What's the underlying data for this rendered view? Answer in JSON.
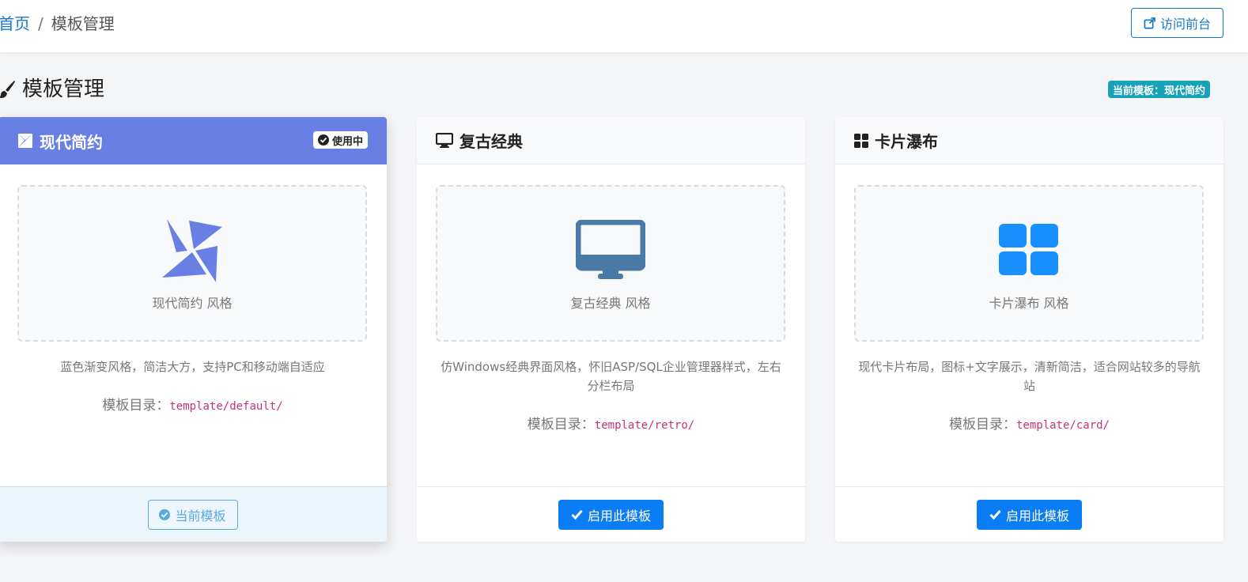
{
  "breadcrumb": {
    "home": "首页",
    "separator": "/",
    "current": "模板管理"
  },
  "header": {
    "visit_label": "访问前台"
  },
  "page": {
    "title": "模板管理",
    "current_badge": "当前模板：现代简约"
  },
  "colors": {
    "accent": "#1677c8",
    "active_head": "#6a7fe4",
    "badge": "#17a2b8",
    "primary": "#0a7cf4"
  },
  "templates": [
    {
      "name": "现代简约",
      "icon": "pinwheel-icon",
      "active": true,
      "in_use_label": "使用中",
      "style_label": "现代简约 风格",
      "description": "蓝色渐变风格，简洁大方，支持PC和移动端自适应",
      "dir_label": "模板目录：",
      "dir_path": "template/default/",
      "button_label": "当前模板"
    },
    {
      "name": "复古经典",
      "icon": "desktop-icon",
      "active": false,
      "style_label": "复古经典 风格",
      "description": "仿Windows经典界面风格，怀旧ASP/SQL企业管理器样式，左右分栏布局",
      "dir_label": "模板目录：",
      "dir_path": "template/retro/",
      "button_label": "启用此模板"
    },
    {
      "name": "卡片瀑布",
      "icon": "grid-icon",
      "active": false,
      "style_label": "卡片瀑布 风格",
      "description": "现代卡片布局，图标+文字展示，清新简洁，适合网站较多的导航站",
      "dir_label": "模板目录：",
      "dir_path": "template/card/",
      "button_label": "启用此模板"
    }
  ]
}
